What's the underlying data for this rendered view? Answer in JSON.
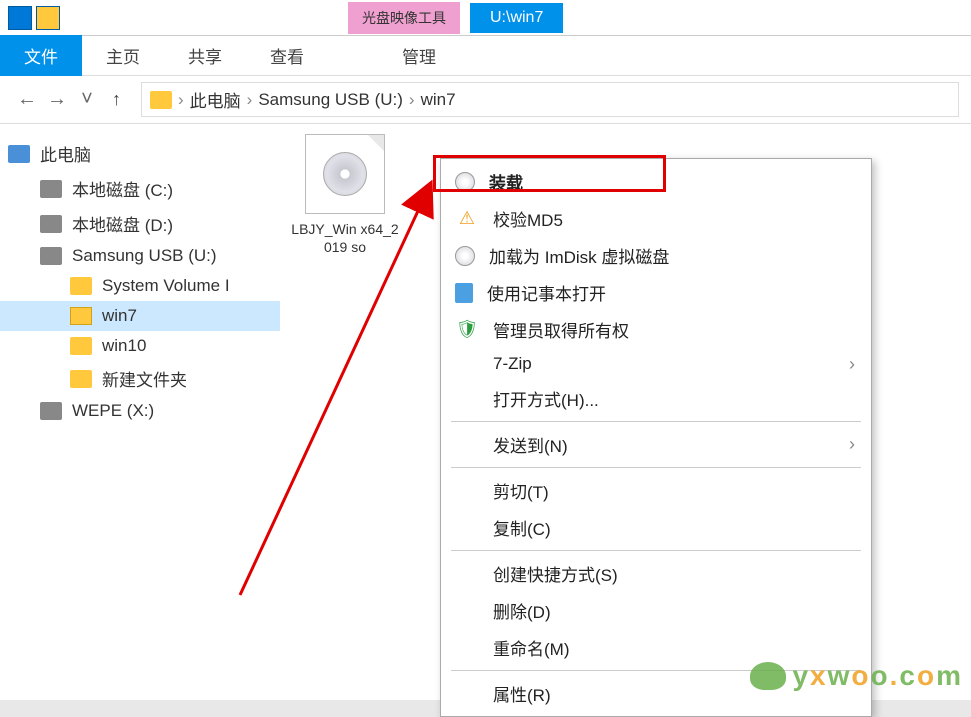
{
  "titlebar": {
    "tool_tab": "光盘映像工具",
    "path": "U:\\win7"
  },
  "menu": {
    "file": "文件",
    "home": "主页",
    "share": "共享",
    "view": "查看",
    "manage": "管理"
  },
  "nav": {
    "back": "←",
    "forward": "→",
    "up": "↑"
  },
  "breadcrumb": {
    "sep": "›",
    "items": [
      "此电脑",
      "Samsung USB (U:)",
      "win7"
    ]
  },
  "tree": {
    "pc": "此电脑",
    "disk_c": "本地磁盘 (C:)",
    "disk_d": "本地磁盘 (D:)",
    "usb": "Samsung USB (U:)",
    "sysvol": "System Volume I",
    "win7": "win7",
    "win10": "win10",
    "newfolder": "新建文件夹",
    "wepe": "WEPE (X:)"
  },
  "file": {
    "name": "LBJY_Win x64_2019 so"
  },
  "context": {
    "mount": "装载",
    "md5": "校验MD5",
    "imdisk": "加载为 ImDisk 虚拟磁盘",
    "notepad": "使用记事本打开",
    "admin_own": "管理员取得所有权",
    "sevenzip": "7-Zip",
    "openwith": "打开方式(H)...",
    "sendto": "发送到(N)",
    "cut": "剪切(T)",
    "copy": "复制(C)",
    "shortcut": "创建快捷方式(S)",
    "delete": "删除(D)",
    "rename": "重命名(M)",
    "properties": "属性(R)"
  },
  "watermark": {
    "text_parts": [
      "y",
      "x",
      "w",
      "o",
      "o",
      ".",
      "c",
      "o",
      "m"
    ]
  }
}
